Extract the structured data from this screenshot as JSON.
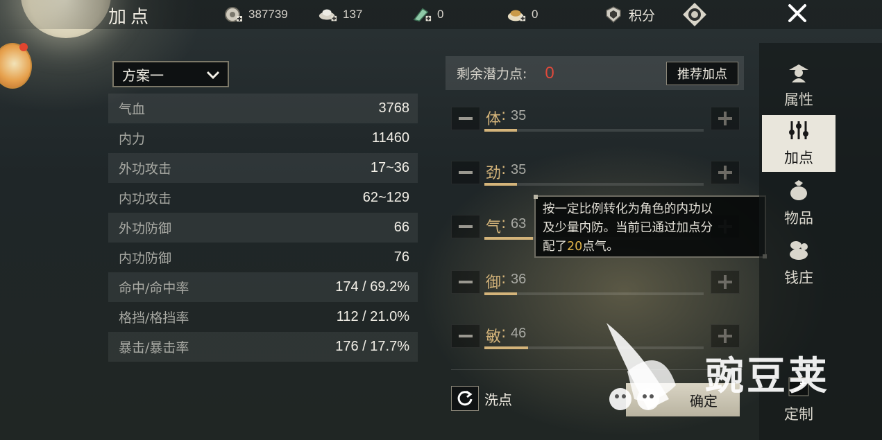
{
  "header": {
    "title": "加点",
    "resources": [
      {
        "icon": "silver-coin-plus-icon",
        "value": "387739"
      },
      {
        "icon": "ingot-plus-icon",
        "value": "137"
      },
      {
        "icon": "jade-plus-icon",
        "value": "0"
      },
      {
        "icon": "pouch-plus-icon",
        "value": "0"
      }
    ],
    "points_label": "积分"
  },
  "scheme": {
    "selected": "方案一"
  },
  "stats": [
    {
      "name": "气血",
      "value": "3768"
    },
    {
      "name": "内力",
      "value": "11460"
    },
    {
      "name": "外功攻击",
      "value": "17~36"
    },
    {
      "name": "内功攻击",
      "value": "62~129"
    },
    {
      "name": "外功防御",
      "value": "66"
    },
    {
      "name": "内功防御",
      "value": "76"
    },
    {
      "name": "命中/命中率",
      "value": "174 / 69.2%"
    },
    {
      "name": "格挡/格挡率",
      "value": "112 / 21.0%"
    },
    {
      "name": "暴击/暴击率",
      "value": "176 / 17.7%"
    }
  ],
  "potential": {
    "label": "剩余潜力点:",
    "value": "0",
    "recommend_label": "推荐加点"
  },
  "attributes": [
    {
      "name": "体",
      "colon": ":",
      "value": "35",
      "fill": 0.15
    },
    {
      "name": "劲",
      "colon": ":",
      "value": "35",
      "fill": 0.15
    },
    {
      "name": "气",
      "colon": ":",
      "value": "63",
      "fill": 0.22
    },
    {
      "name": "御",
      "colon": ":",
      "value": "36",
      "fill": 0.15
    },
    {
      "name": "敏",
      "colon": ":",
      "value": "46",
      "fill": 0.2
    }
  ],
  "tooltip": {
    "line1": "按一定比例转化为角色的内功以",
    "line2": "及少量内防。当前已通过加点分",
    "line3_a": "配了",
    "line3_hl": "20",
    "line3_b": "点气。"
  },
  "actions": {
    "reset_label": "洗点",
    "confirm_label": "确定"
  },
  "sidebar": {
    "tabs": [
      {
        "label": "属性",
        "icon": "character-hat-icon",
        "active": false
      },
      {
        "label": "加点",
        "icon": "sliders-icon",
        "active": true
      },
      {
        "label": "物品",
        "icon": "bag-icon",
        "active": false
      },
      {
        "label": "钱庄",
        "icon": "money-bag-icon",
        "active": false
      },
      {
        "label": "定制",
        "icon": "sparkle-wand-icon",
        "active": false
      }
    ]
  },
  "watermark": {
    "text": "豌豆荚"
  },
  "colors": {
    "accent_gold": "#d4b47a",
    "potential_red": "#e0493b",
    "highlight": "#e2b44a"
  }
}
